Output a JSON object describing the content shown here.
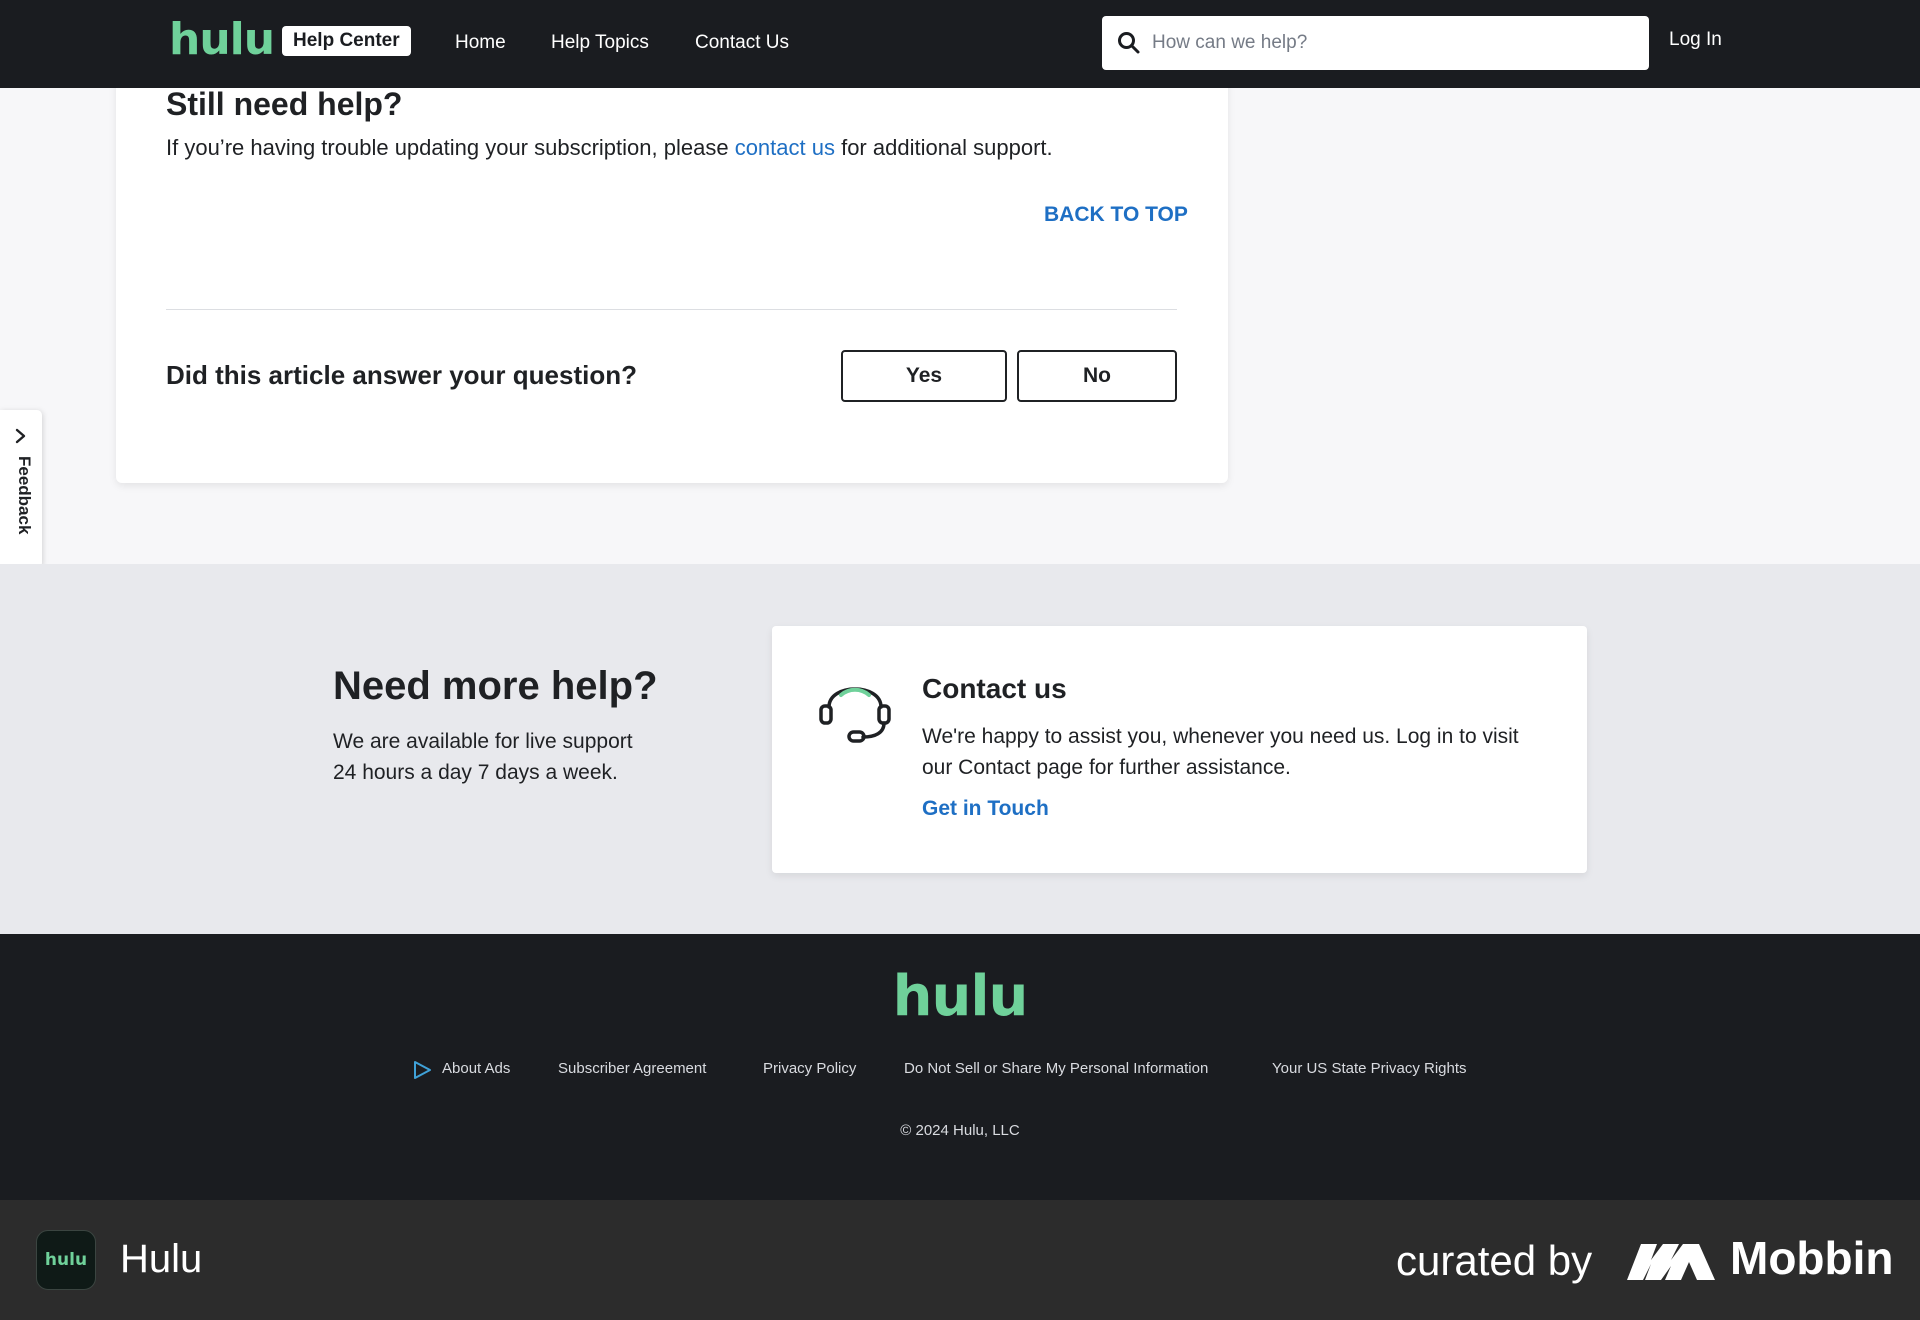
{
  "header": {
    "logo": "hulu",
    "badge": "Help Center",
    "nav": [
      "Home",
      "Help Topics",
      "Contact Us"
    ],
    "search_placeholder": "How can we help?",
    "login": "Log In"
  },
  "article": {
    "still_title": "Still need help?",
    "still_text_before": "If you’re having trouble updating your subscription, please ",
    "still_link": "contact us",
    "still_text_after": " for additional support.",
    "back_to_top": "BACK TO TOP",
    "question": "Did this article answer your question?",
    "yes": "Yes",
    "no": "No"
  },
  "feedback": {
    "label": "Feedback"
  },
  "help": {
    "title": "Need more help?",
    "line1": "We are available for live support",
    "line2": "24 hours a day 7 days a week.",
    "contact_title": "Contact us",
    "contact_text": "We're happy to assist you, whenever you need us. Log in to visit our Contact page for further assistance.",
    "contact_link": "Get in Touch"
  },
  "footer": {
    "logo": "hulu",
    "links": [
      "About Ads",
      "Subscriber Agreement",
      "Privacy Policy",
      "Do Not Sell or Share My Personal Information",
      "Your US State Privacy Rights"
    ],
    "copyright": "© 2024 Hulu, LLC"
  },
  "bottom_bar": {
    "app_icon_text": "hulu",
    "app_name": "Hulu",
    "curated": "curated by",
    "brand": "Mobbin"
  },
  "colors": {
    "brand_green": "#6fd19a",
    "link_blue": "#1e6fc4",
    "header_bg": "#1a1c20"
  }
}
